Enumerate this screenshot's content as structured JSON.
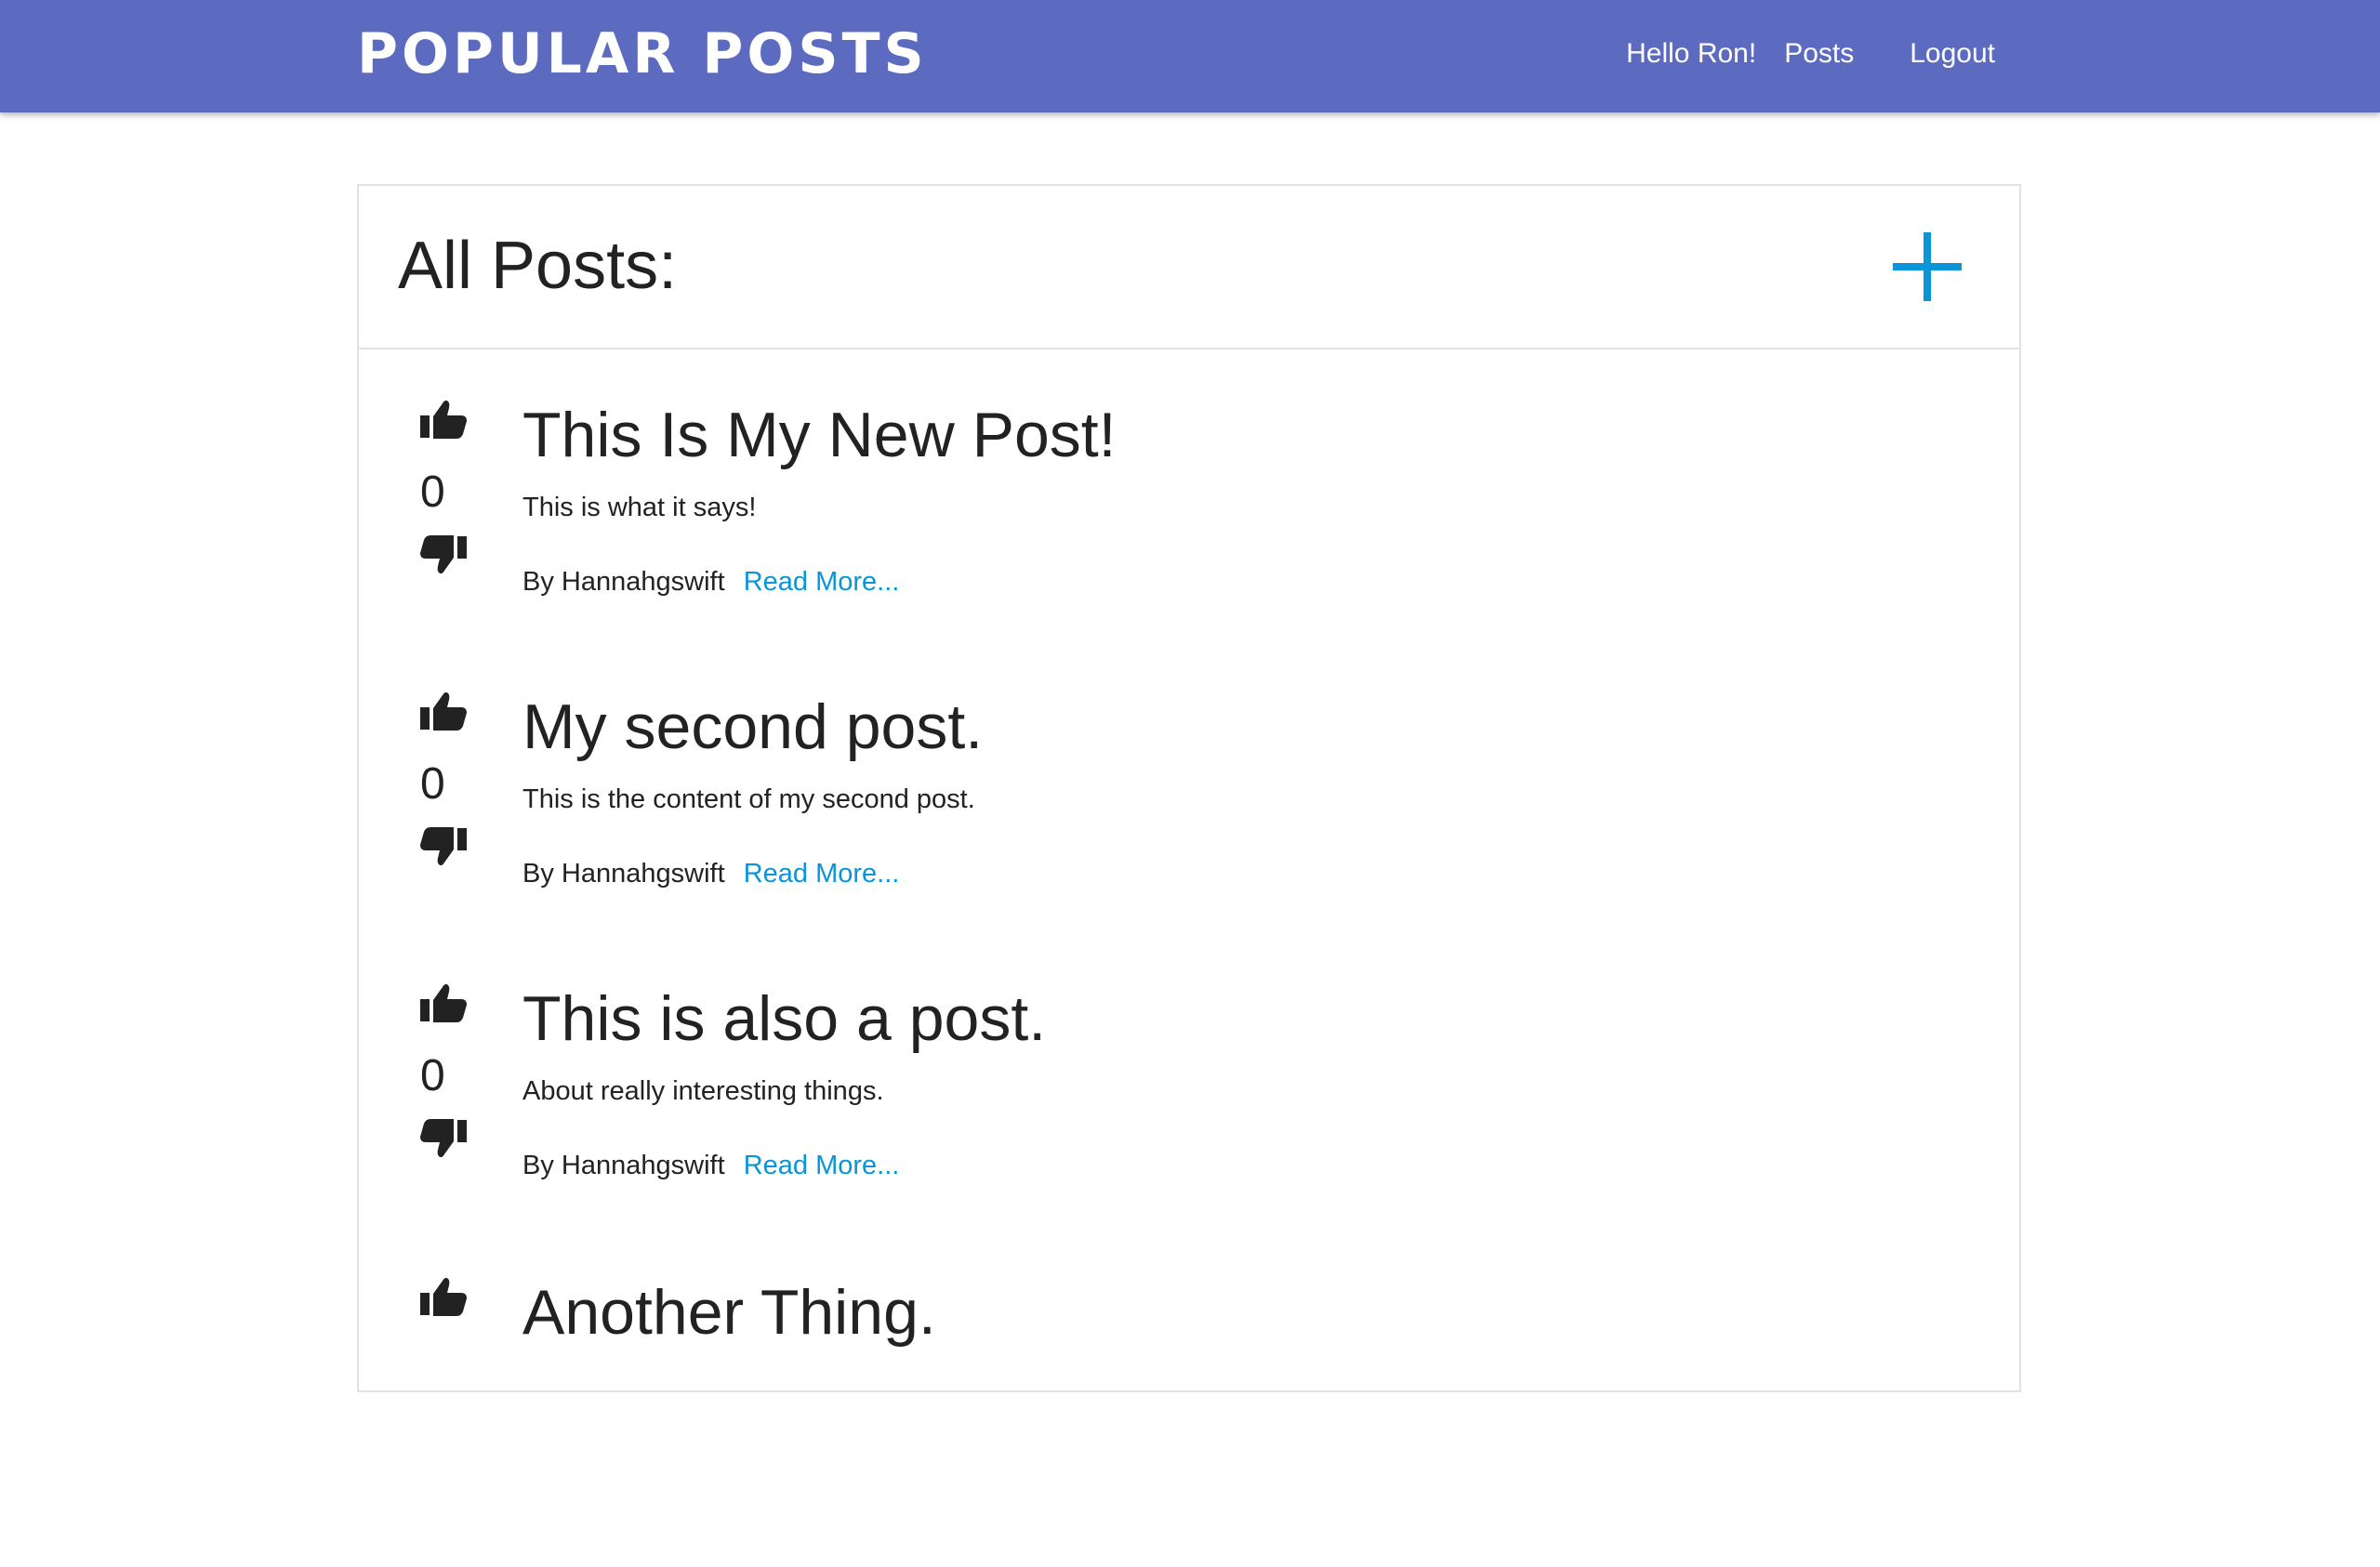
{
  "header": {
    "brand": "POPULAR POSTS",
    "greeting": "Hello Ron!",
    "posts_link": "Posts",
    "logout_link": "Logout",
    "background_color": "#5c6bc0"
  },
  "main": {
    "title": "All Posts:",
    "add_icon": "plus-icon",
    "accent_color": "#0a95d8"
  },
  "posts": [
    {
      "title": "This Is My New Post!",
      "content": "This is what it says!",
      "author_prefix": "By",
      "author": "Hannahgswift",
      "read_more": "Read More...",
      "votes": "0"
    },
    {
      "title": "My second post.",
      "content": "This is the content of my second post.",
      "author_prefix": "By",
      "author": "Hannahgswift",
      "read_more": "Read More...",
      "votes": "0"
    },
    {
      "title": "This is also a post.",
      "content": "About really interesting things.",
      "author_prefix": "By",
      "author": "Hannahgswift",
      "read_more": "Read More...",
      "votes": "0"
    },
    {
      "title": "Another Thing.",
      "content": "",
      "author_prefix": "",
      "author": "",
      "read_more": "",
      "votes": ""
    }
  ]
}
